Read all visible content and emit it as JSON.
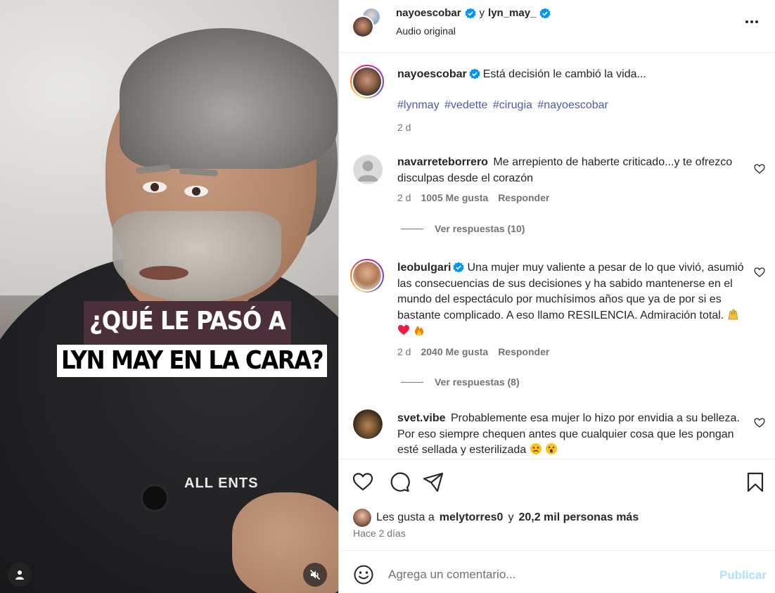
{
  "colors": {
    "accent": "#0095f6",
    "publish_disabled": "#b2dffc",
    "hashtag": "#4e59b8",
    "caption_bg": "#4b2f3a",
    "verified": "#0095f6",
    "heart_red": "#ed1d3f"
  },
  "media": {
    "caption_line1": "¿QUÉ LE PASÓ A",
    "caption_line2": "LYN MAY EN LA CARA?",
    "shirt_text": "ALL ENTS",
    "user_icon": "user-icon",
    "mute_icon": "muted-speaker-icon"
  },
  "header": {
    "user1": "nayoescobar",
    "connector": "y",
    "user2": "lyn_may_",
    "subtitle": "Audio original",
    "more_icon": "more-horizontal-icon"
  },
  "post": {
    "username": "nayoescobar",
    "caption": "Está decisión le cambió la vida...",
    "hashtags": [
      "#lynmay",
      "#vedette",
      "#cirugia",
      "#nayoescobar"
    ],
    "time": "2 d"
  },
  "comments": [
    {
      "username": "navarreteborrero",
      "verified": false,
      "text": "Me arrepiento de haberte criticado...y te ofrezco disculpas desde el corazón",
      "time": "2 d",
      "likes": "1005 Me gusta",
      "reply": "Responder",
      "view_replies": "Ver respuestas (10)"
    },
    {
      "username": "leobulgari",
      "verified": true,
      "text": "Una mujer muy valiente a pesar de lo que vivió, asumió las consecuencias de sus decisiones y ha sabido mantenerse en el mundo del espectáculo por muchísimos años que ya de por si es bastante complicado. A eso llamo RESILENCIA. Admiración total.",
      "emojis": [
        "raised-hands-emoji",
        "red-heart-emoji",
        "fire-emoji"
      ],
      "time": "2 d",
      "likes": "2040 Me gusta",
      "reply": "Responder",
      "view_replies": "Ver respuestas (8)"
    },
    {
      "username": "svet.vibe",
      "verified": false,
      "text": "Probablemente esa mujer lo hizo por envidia a su belleza. Por eso siempre chequen antes que cualquier cosa que les pongan esté sellada y esterilizada",
      "emojis": [
        "sad-face-emoji",
        "surprised-face-emoji"
      ]
    }
  ],
  "actions": {
    "likes_prefix": "Les gusta a",
    "likes_user": "melytorres0",
    "likes_connector": "y",
    "likes_rest": "20,2 mil personas más",
    "date": "Hace 2 días"
  },
  "add_comment": {
    "placeholder": "Agrega un comentario...",
    "publish": "Publicar"
  }
}
